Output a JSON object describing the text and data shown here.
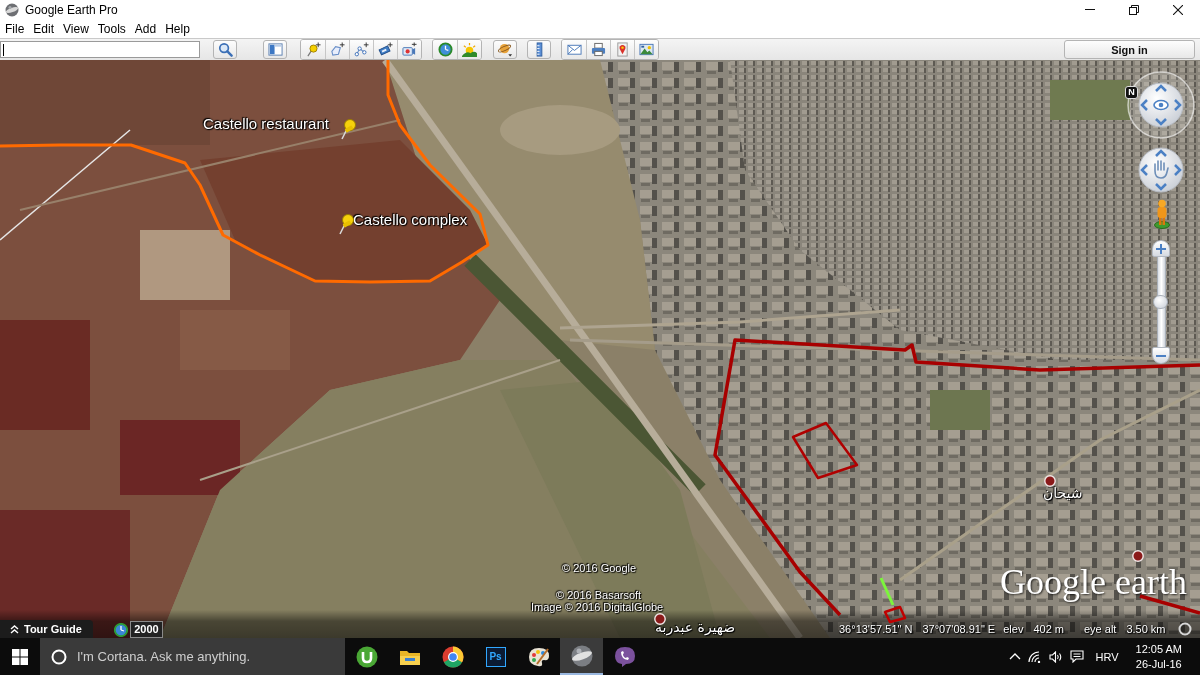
{
  "window": {
    "title": "Google Earth Pro"
  },
  "menu": [
    "File",
    "Edit",
    "View",
    "Tools",
    "Add",
    "Help"
  ],
  "toolbar": {
    "sign_in": "Sign in"
  },
  "map": {
    "overlays": [
      {
        "kind": "line",
        "color": "#ff6a00"
      },
      {
        "kind": "line",
        "color": "#a80000"
      },
      {
        "kind": "shape",
        "color": "#b00000"
      },
      {
        "kind": "shape",
        "color": "#c00000"
      },
      {
        "kind": "line",
        "color": "#7cf53c"
      },
      {
        "kind": "line",
        "color": "#a80000"
      }
    ],
    "placemarks": [
      {
        "label": "Castello restaurant"
      },
      {
        "label": "Castello complex"
      }
    ],
    "places": [
      {
        "kind": "labeled",
        "name": "شيحان"
      },
      {
        "kind": "labeled",
        "name": "ضهيرة عبدربه"
      },
      {
        "kind": "dot"
      }
    ],
    "compass": "N",
    "zoom_slider": {
      "level": 0.5
    },
    "attributions": [
      "© 2016 Google",
      "© 2016 Basarsoft",
      "Image © 2016 DigitalGlobe"
    ],
    "logo": "Google earth",
    "tour_guide": "Tour Guide",
    "time_year": "2000"
  },
  "status_bar": {
    "latitude": "36°13'57.51\" N",
    "longitude": "37°07'08.91\" E",
    "elevation_label": "elev",
    "elevation": "402 m",
    "eye_alt_label": "eye alt",
    "eye_alt": "3.50 km"
  },
  "taskbar": {
    "search_placeholder": "I'm Cortana. Ask me anything.",
    "apps": [
      {
        "kind": "torrent",
        "selected": false
      },
      {
        "kind": "folder",
        "selected": false
      },
      {
        "kind": "browser",
        "selected": false
      },
      {
        "kind": "tile",
        "label": "Ps",
        "selected": false
      },
      {
        "kind": "paint",
        "selected": false
      },
      {
        "kind": "earth",
        "selected": true
      },
      {
        "kind": "chat",
        "selected": false
      }
    ],
    "language": "HRV",
    "time": "12:05 AM",
    "date": "26-Jul-16"
  }
}
